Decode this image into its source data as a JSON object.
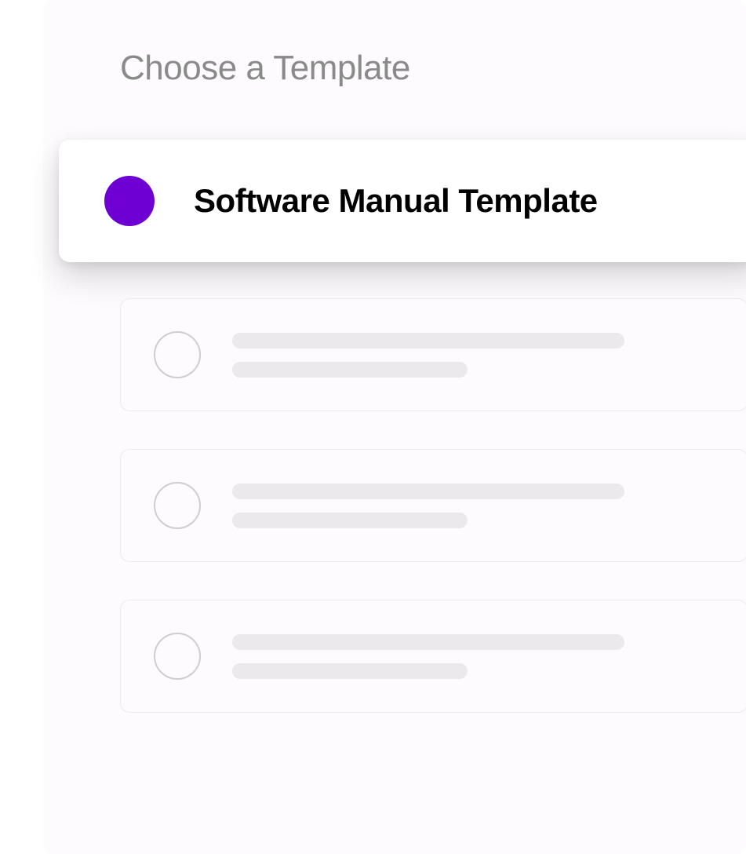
{
  "heading": "Choose a Template",
  "selected_template": {
    "label": "Software Manual Template",
    "color": "#6e00d4"
  },
  "placeholder_options": [
    {
      "selected": false
    },
    {
      "selected": false
    },
    {
      "selected": false
    }
  ]
}
